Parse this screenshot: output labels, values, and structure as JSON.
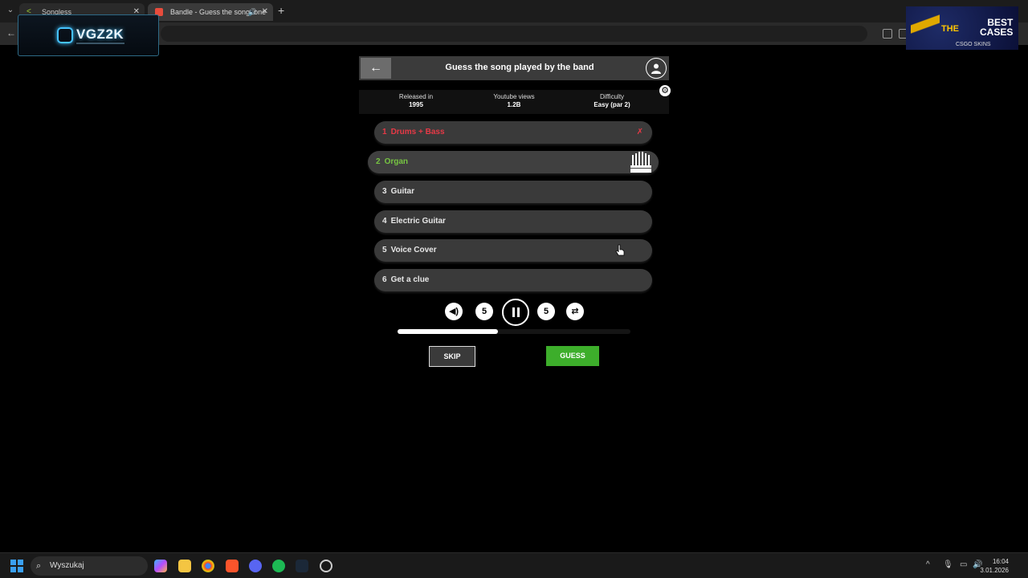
{
  "browser": {
    "tabs": [
      {
        "title": "Songless",
        "active": false
      },
      {
        "title": "Bandle - Guess the song, one",
        "active": true
      }
    ]
  },
  "overlay": {
    "logo_text": "VGZ2K"
  },
  "ad": {
    "line1": "THE",
    "line2": "BEST",
    "line3": "CASES",
    "brand": "CSGO SKINS"
  },
  "app": {
    "title": "Guess the song played by the band",
    "info": [
      {
        "label": "Released in",
        "value": "1995"
      },
      {
        "label": "Youtube views",
        "value": "1.2B"
      },
      {
        "label": "Difficulty",
        "value": "Easy (par 2)"
      }
    ],
    "clues": [
      {
        "num": "1",
        "label": "Drums + Bass",
        "state": "wrong"
      },
      {
        "num": "2",
        "label": "Organ",
        "state": "playing"
      },
      {
        "num": "3",
        "label": "Guitar",
        "state": "locked"
      },
      {
        "num": "4",
        "label": "Electric Guitar",
        "state": "locked"
      },
      {
        "num": "5",
        "label": "Voice Cover",
        "state": "locked"
      },
      {
        "num": "6",
        "label": "Get a clue",
        "state": "locked"
      }
    ],
    "wrong_mark": "✗",
    "progress_fraction": 0.43,
    "skip_label": "SKIP",
    "guess_label": "GUESS",
    "colors": {
      "wrong": "#e63946",
      "active": "#76c442",
      "guess": "#3dae2b"
    }
  },
  "taskbar": {
    "search_placeholder": "Wyszukaj",
    "time": "16:04",
    "date": "3.01.2026"
  }
}
